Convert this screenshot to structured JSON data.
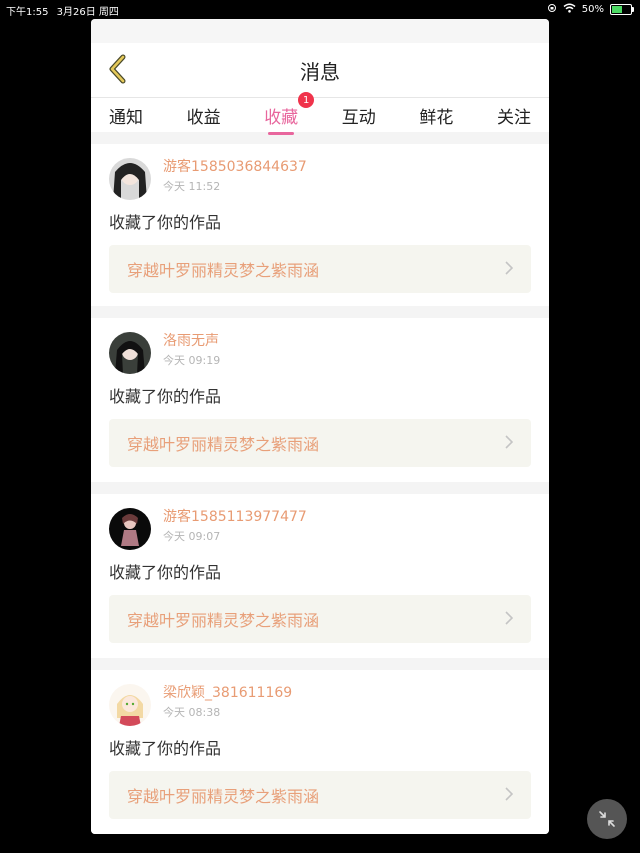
{
  "status": {
    "time": "下午1:55",
    "date": "3月26日 周四",
    "battery": "50%"
  },
  "header": {
    "title": "消息"
  },
  "tabs": [
    {
      "label": "通知"
    },
    {
      "label": "收益"
    },
    {
      "label": "收藏",
      "active": true,
      "badge": "1"
    },
    {
      "label": "互动"
    },
    {
      "label": "鲜花"
    },
    {
      "label": "关注"
    }
  ],
  "messages": [
    {
      "user": "游客1585036844637",
      "time": "今天 11:52",
      "action": "收藏了你的作品",
      "work": "穿越叶罗丽精灵梦之紫雨涵"
    },
    {
      "user": "洛雨无声",
      "time": "今天 09:19",
      "action": "收藏了你的作品",
      "work": "穿越叶罗丽精灵梦之紫雨涵"
    },
    {
      "user": "游客1585113977477",
      "time": "今天 09:07",
      "action": "收藏了你的作品",
      "work": "穿越叶罗丽精灵梦之紫雨涵"
    },
    {
      "user": "梁欣颖_381611169",
      "time": "今天 08:38",
      "action": "收藏了你的作品",
      "work": "穿越叶罗丽精灵梦之紫雨涵"
    }
  ],
  "colors": {
    "accent": "#e8669d",
    "username": "#e89b73",
    "badge": "#f0334b"
  }
}
